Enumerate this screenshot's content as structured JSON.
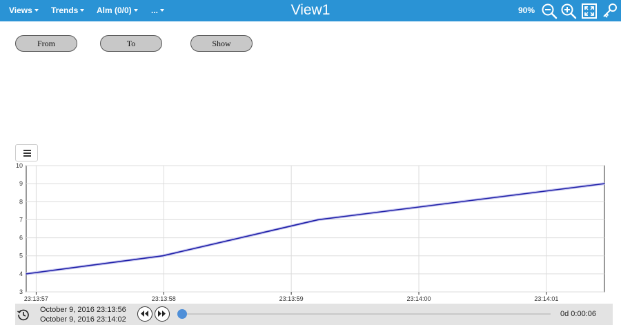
{
  "topbar": {
    "nav": [
      {
        "label": "Views"
      },
      {
        "label": "Trends"
      },
      {
        "label": "Alm (0/0)"
      },
      {
        "label": "..."
      }
    ],
    "title": "View1",
    "zoom": "90%",
    "icons": [
      "zoom-out-icon",
      "zoom-in-icon",
      "fullscreen-icon",
      "key-icon"
    ]
  },
  "buttons": {
    "from": "From",
    "to": "To",
    "show": "Show"
  },
  "chart_data": {
    "type": "line",
    "title": "",
    "xlabel": "",
    "ylabel": "",
    "ylim": [
      3,
      10
    ],
    "yticks": [
      "3",
      "4",
      "5",
      "6",
      "7",
      "8",
      "9",
      "10"
    ],
    "xticks": [
      "23:13:57",
      "23:13:58",
      "23:13:59",
      "23:14:00",
      "23:14:01"
    ],
    "xlim": [
      "23:13:56.922",
      "23:14:01.455"
    ],
    "grid": true,
    "legend": "none",
    "series": [
      {
        "color": "#1f1fa8",
        "x": [
          "23:13:56.922",
          "23:13:57.992",
          "23:13:59.210",
          "23:14:01.455"
        ],
        "y": [
          4,
          5,
          7,
          9
        ]
      }
    ]
  },
  "footer": {
    "range_start": "October 9, 2016 23:13:56",
    "range_end": "October 9, 2016 23:14:02",
    "duration": "0d 0:00:06",
    "progress": 0
  }
}
